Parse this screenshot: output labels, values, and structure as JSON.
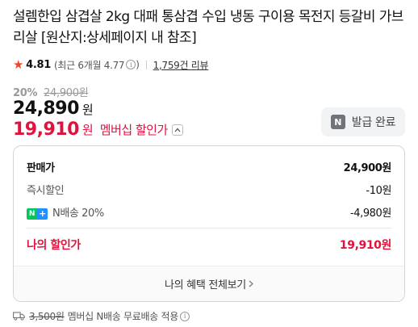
{
  "product": {
    "title": "설렘한입 삼겹살 2kg 대패 통삼겹 수입 냉동 구이용 목전지 등갈비 가브리살 [원산지:상세페이지 내 참조]"
  },
  "rating": {
    "score": "4.81",
    "recent": "(최근 6개월 4.77",
    "review_count": "1,759",
    "review_suffix": "건 리뷰"
  },
  "price": {
    "discount_pct": "20%",
    "original": "24,900원",
    "sale": "24,890",
    "sale_unit": "원",
    "member": "19,910",
    "member_unit": "원",
    "member_label": "멤버십 할인가"
  },
  "coupon": {
    "badge": "N",
    "label": "발급 완료"
  },
  "breakdown": {
    "rows": [
      {
        "label": "판매가",
        "value": "24,900원"
      },
      {
        "label": "즉시할인",
        "value": "-10원"
      },
      {
        "label": "N배송 20%",
        "value": "-4,980원"
      }
    ],
    "total_label": "나의 할인가",
    "total_value": "19,910원",
    "link_label": "나의 혜택 전체보기",
    "npay_n": "N",
    "npay_plus": "+"
  },
  "shipping": {
    "old_fee": "3,500원",
    "text": "멤버십 N배송 무료배송 적용"
  },
  "colors": {
    "accent_red": "#e0123e",
    "star": "#f0442c",
    "naver_green": "#03c75a"
  }
}
